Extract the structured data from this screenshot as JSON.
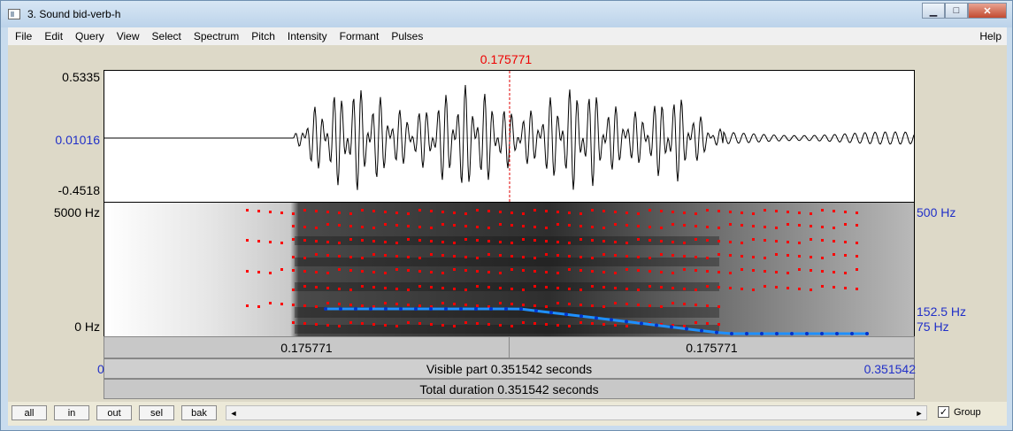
{
  "window": {
    "title": "3. Sound bid-verb-h",
    "controls": {
      "minimize": "▁",
      "maximize": "□",
      "close": "✕"
    }
  },
  "menu": [
    "File",
    "Edit",
    "Query",
    "View",
    "Select",
    "Spectrum",
    "Pitch",
    "Intensity",
    "Formant",
    "Pulses"
  ],
  "menu_help": "Help",
  "cursor": {
    "time_label": "0.175771"
  },
  "waveform": {
    "y_max": "0.5335",
    "y_zero": "0.01016",
    "y_min": "-0.4518"
  },
  "spectrogram": {
    "y_top": "5000 Hz",
    "y_bottom": "0 Hz",
    "pitch_top": "500 Hz",
    "pitch_current": "152.5 Hz",
    "pitch_bottom": "75 Hz"
  },
  "time_bars": {
    "left_half": "0.175771",
    "right_half": "0.175771",
    "visible_start": "0",
    "visible_label": "Visible part 0.351542 seconds",
    "visible_end": "0.351542",
    "total_label": "Total duration 0.351542 seconds"
  },
  "buttons": {
    "all": "all",
    "in": "in",
    "out": "out",
    "sel": "sel",
    "bak": "bak"
  },
  "scrollbar": {
    "left_arrow": "◄",
    "right_arrow": "►"
  },
  "group": {
    "label": "Group",
    "checked": "✓"
  },
  "colors": {
    "cursor": "#e00000",
    "axis_blue": "#2130c8",
    "formant": "#ff0000",
    "pitch": "#1e90ff"
  }
}
